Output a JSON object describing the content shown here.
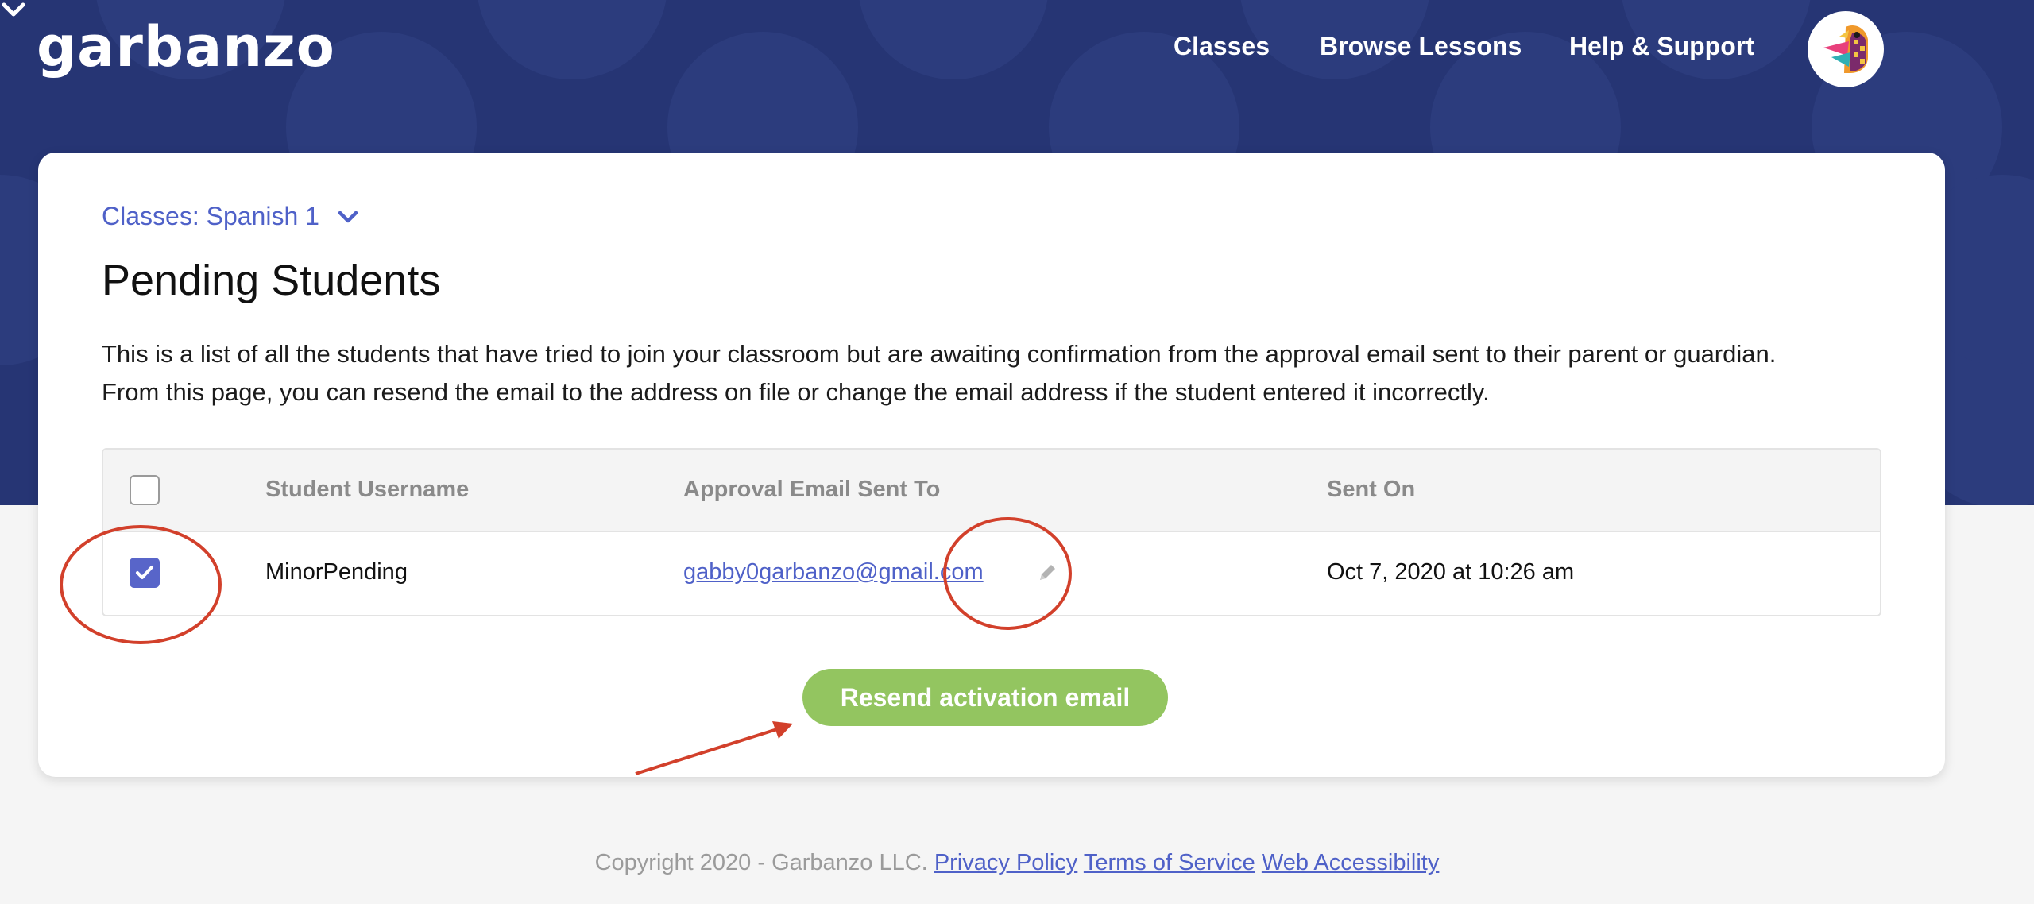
{
  "brand": {
    "logo_text": "garbanzo"
  },
  "nav": {
    "items": [
      {
        "label": "Classes"
      },
      {
        "label": "Browse Lessons"
      },
      {
        "label": "Help & Support"
      }
    ],
    "avatar_icon": "parrot-avatar-icon",
    "menu_icon": "chevron-down-icon"
  },
  "page": {
    "breadcrumb": "Classes: Spanish 1",
    "title": "Pending Students",
    "description_line1": "This is a list of all the students that have tried to join your classroom but are awaiting confirmation from the approval email sent to their parent or guardian.",
    "description_line2": "From this page, you can resend the email to the address on file or change the email address if the student entered it incorrectly."
  },
  "table": {
    "headers": {
      "username": "Student Username",
      "email": "Approval Email Sent To",
      "sent_on": "Sent On"
    },
    "rows": [
      {
        "checked": true,
        "username": "MinorPending",
        "email": "gabby0garbanzo@gmail.com",
        "sent_on": "Oct 7, 2020 at 10:26 am"
      }
    ]
  },
  "actions": {
    "resend_label": "Resend activation email"
  },
  "footer": {
    "copyright": "Copyright 2020 - Garbanzo LLC.",
    "links": {
      "privacy": "Privacy Policy",
      "terms": "Terms of Service",
      "accessibility": "Web Accessibility"
    }
  },
  "colors": {
    "header_bg": "#263574",
    "accent": "#4f61c8",
    "button": "#93c560",
    "annotation": "#d2402b"
  }
}
